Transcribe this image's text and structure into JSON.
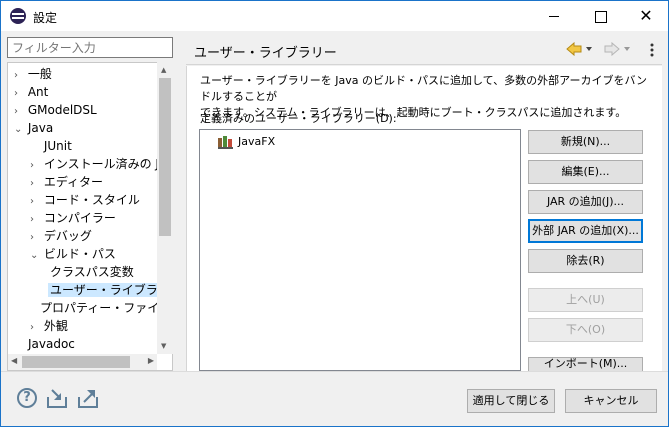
{
  "window": {
    "title": "設定"
  },
  "filter": {
    "placeholder": "フィルター入力"
  },
  "tree": {
    "items": [
      {
        "label": "一般",
        "arrow": "›"
      },
      {
        "label": "Ant",
        "arrow": "›"
      },
      {
        "label": "GModelDSL",
        "arrow": "›"
      },
      {
        "label": "Java",
        "arrow": "⌄"
      },
      {
        "label": "JUnit",
        "arrow": ""
      },
      {
        "label": "インストール済みの JRE",
        "arrow": "›"
      },
      {
        "label": "エディター",
        "arrow": "›"
      },
      {
        "label": "コード・スタイル",
        "arrow": "›"
      },
      {
        "label": "コンパイラー",
        "arrow": "›"
      },
      {
        "label": "デバッグ",
        "arrow": "›"
      },
      {
        "label": "ビルド・パス",
        "arrow": "⌄"
      },
      {
        "label": "クラスパス変数",
        "arrow": ""
      },
      {
        "label": "ユーザー・ライブラリー",
        "arrow": ""
      },
      {
        "label": "プロパティー・ファイル・エディ",
        "arrow": ""
      },
      {
        "label": "外観",
        "arrow": "›"
      },
      {
        "label": "Javadoc",
        "arrow": ""
      }
    ]
  },
  "page": {
    "title": "ユーザー・ライブラリー",
    "description_line1": "ユーザー・ライブラリーを Java のビルド・パスに追加して、多数の外部アーカイブをバンドルすることが",
    "description_line2": "できます。システム・ライブラリーは、起動時にブート・クラスパスに追加されます。",
    "list_label": "定義済みのユーザー・ライブラリー(D):",
    "libraries": [
      "JavaFX"
    ]
  },
  "buttons": {
    "new": "新規(N)...",
    "edit": "編集(E)...",
    "add_jar": "JAR の追加(J)...",
    "add_external_jar": "外部 JAR の追加(X)...",
    "remove": "除去(R)",
    "up": "上へ(U)",
    "down": "下へ(O)",
    "import": "インポート(M)...",
    "apply_close": "適用して閉じる",
    "cancel": "キャンセル"
  },
  "colors": {
    "accent": "#0078d7",
    "selection": "#cce8ff",
    "title_border": "#1a73c9"
  },
  "icons": [
    "app-icon",
    "back-arrow-icon",
    "forward-arrow-icon",
    "menu-dots-icon",
    "help-icon",
    "import-icon",
    "export-icon",
    "jar-library-icon"
  ]
}
